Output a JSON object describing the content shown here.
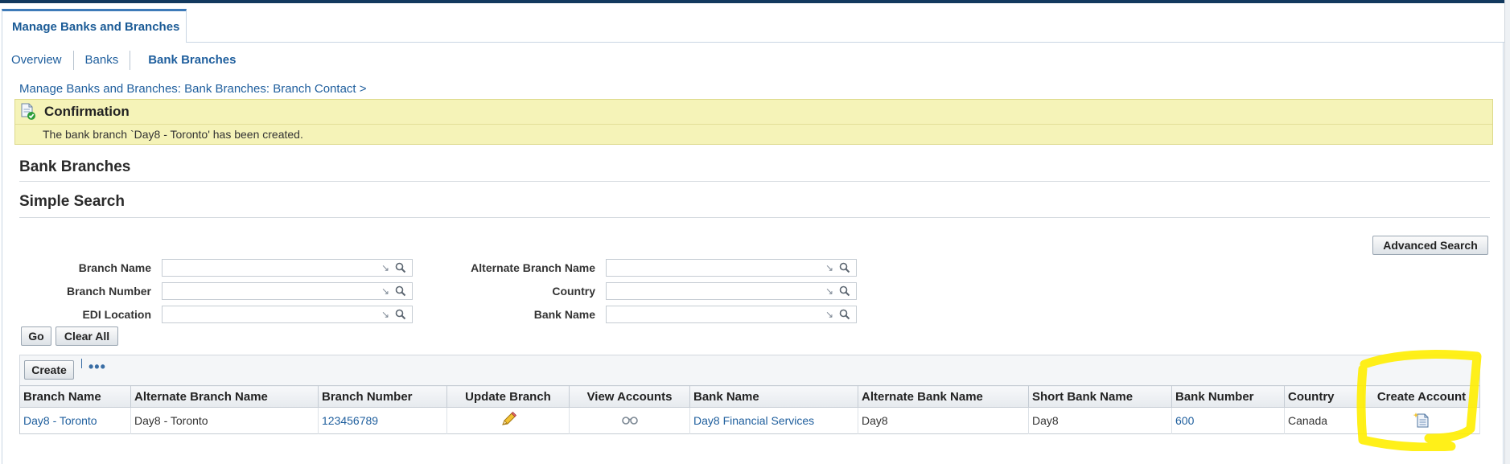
{
  "main_tab": "Manage Banks and Branches",
  "subtabs": [
    "Overview",
    "Banks",
    "Bank Branches"
  ],
  "breadcrumb": "Manage Banks and Branches: Bank Branches: Branch Contact  >",
  "confirmation": {
    "title": "Confirmation",
    "message": "The bank branch `Day8 - Toronto' has been created."
  },
  "section_title": "Bank Branches",
  "search": {
    "title": "Simple Search",
    "advanced_label": "Advanced Search",
    "fields_left": [
      {
        "label": "Branch Name",
        "value": ""
      },
      {
        "label": "Branch Number",
        "value": ""
      },
      {
        "label": "EDI Location",
        "value": ""
      }
    ],
    "fields_right": [
      {
        "label": "Alternate Branch Name",
        "value": ""
      },
      {
        "label": "Country",
        "value": ""
      },
      {
        "label": "Bank Name",
        "value": ""
      }
    ],
    "go_label": "Go",
    "clear_label": "Clear All"
  },
  "table": {
    "create_label": "Create",
    "columns": [
      "Branch Name",
      "Alternate Branch Name",
      "Branch Number",
      "Update Branch",
      "View Accounts",
      "Bank Name",
      "Alternate Bank Name",
      "Short Bank Name",
      "Bank Number",
      "Country",
      "Create Account"
    ],
    "rows": [
      {
        "branch_name": "Day8 - Toronto",
        "alternate_branch_name": "Day8 - Toronto",
        "branch_number": "123456789",
        "update_icon": "pencil-icon",
        "view_icon": "glasses-icon",
        "bank_name": "Day8 Financial Services",
        "alternate_bank_name": "Day8",
        "short_bank_name": "Day8",
        "bank_number": "600",
        "country": "Canada",
        "create_icon": "create-document-icon"
      }
    ]
  },
  "colors": {
    "link": "#1e5e9d",
    "confirmation_bg": "#f5f3b8",
    "highlight": "#ffee00",
    "top_bar": "#12395e"
  }
}
